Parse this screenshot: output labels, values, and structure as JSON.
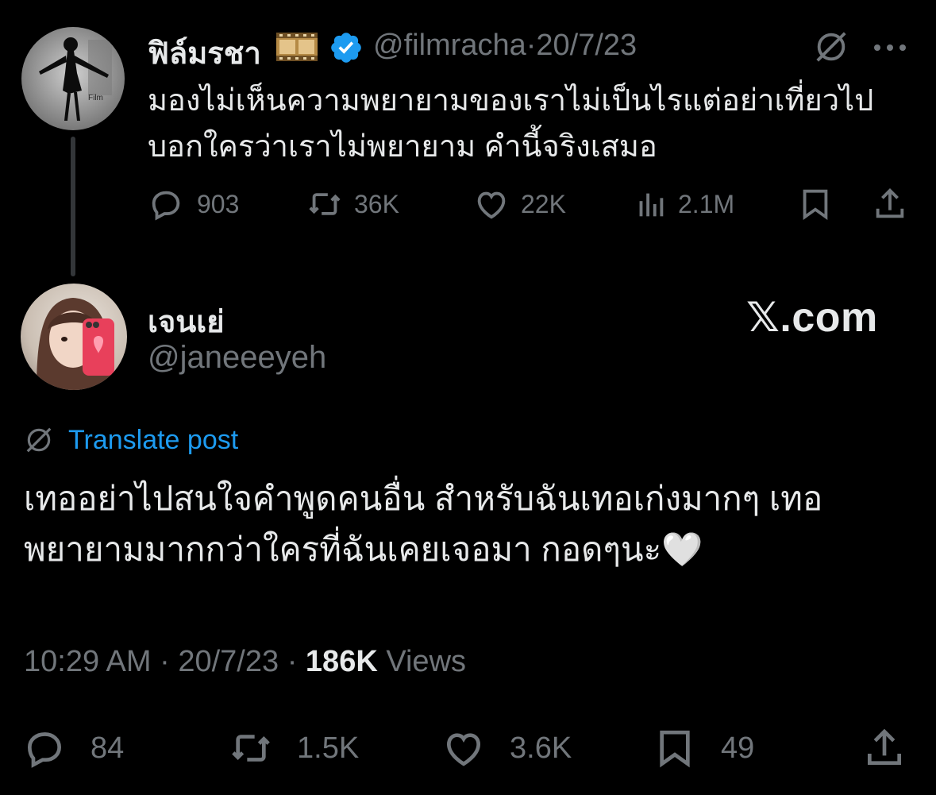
{
  "original_post": {
    "display_name": "ฟิล์มรชา",
    "name_emoji": "film-frames-emoji",
    "handle": "@filmracha",
    "separator": "·",
    "date": "20/7/23",
    "text": "มองไม่เห็นความพยายามของเราไม่เป็นไรแต่อย่าเที่ยวไปบอกใครว่าเราไม่พยายาม คำนี้จริงเสมอ",
    "stats": {
      "replies": "903",
      "reposts": "36K",
      "likes": "22K",
      "views": "2.1M"
    }
  },
  "reply_post": {
    "display_name": "เจนเย่",
    "handle": "@janeeeyeh",
    "watermark": "𝕏.com",
    "translate_label": "Translate post",
    "text": "เทออย่าไปสนใจคำพูดคนอื่น สำหรับฉันเทอเก่งมากๆ เทอพยายามมากกว่าใครที่ฉันเคยเจอมา กอดๆนะ🤍",
    "time": "10:29 AM",
    "separator1": "·",
    "date": "20/7/23",
    "separator2": "·",
    "views_count": "186K",
    "views_label": "Views",
    "stats": {
      "replies": "84",
      "reposts": "1.5K",
      "likes": "3.6K",
      "bookmarks": "49"
    }
  },
  "colors": {
    "background": "#000000",
    "text": "#e7e9ea",
    "muted": "#71767b",
    "link": "#1d9bf0",
    "verified": "#1d9bf0"
  }
}
